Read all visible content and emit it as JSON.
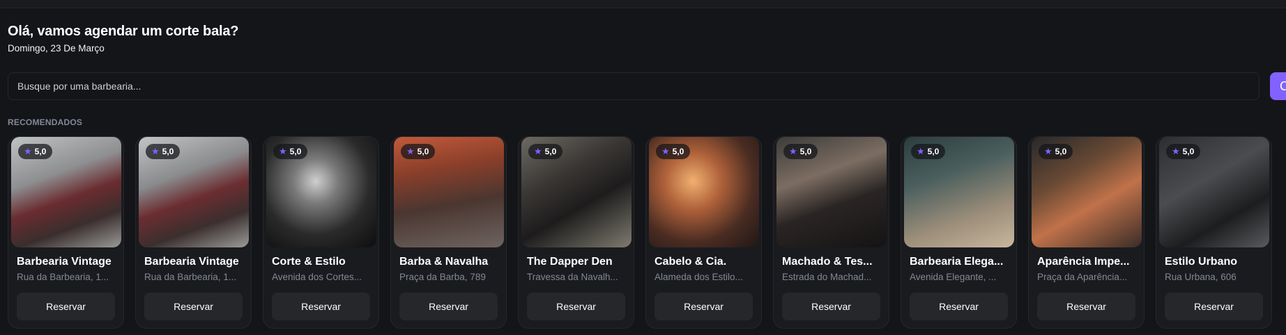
{
  "header": {
    "greeting": "Olá, vamos agendar um corte bala?",
    "date": "Domingo, 23 De Março"
  },
  "search": {
    "placeholder": "Busque por uma barbearia...",
    "button_icon": "search-icon",
    "button_label": "C"
  },
  "section": {
    "title": "RECOMENDADOS"
  },
  "colors": {
    "accent": "#8162ff",
    "background": "#141519",
    "card": "#1a1b1f",
    "muted": "#838896"
  },
  "barbershops": [
    {
      "name": "Barbearia Vintage",
      "address": "Rua da Barbearia, 1...",
      "rating": "5,0",
      "button": "Reservar"
    },
    {
      "name": "Barbearia Vintage",
      "address": "Rua da Barbearia, 1...",
      "rating": "5,0",
      "button": "Reservar"
    },
    {
      "name": "Corte & Estilo",
      "address": "Avenida dos Cortes...",
      "rating": "5,0",
      "button": "Reservar"
    },
    {
      "name": "Barba & Navalha",
      "address": "Praça da Barba, 789",
      "rating": "5,0",
      "button": "Reservar"
    },
    {
      "name": "The Dapper Den",
      "address": "Travessa da Navalh...",
      "rating": "5,0",
      "button": "Reservar"
    },
    {
      "name": "Cabelo & Cia.",
      "address": "Alameda dos Estilo...",
      "rating": "5,0",
      "button": "Reservar"
    },
    {
      "name": "Machado & Tes...",
      "address": "Estrada do Machad...",
      "rating": "5,0",
      "button": "Reservar"
    },
    {
      "name": "Barbearia Elega...",
      "address": "Avenida Elegante, ...",
      "rating": "5,0",
      "button": "Reservar"
    },
    {
      "name": "Aparência Impe...",
      "address": "Praça da Aparência...",
      "rating": "5,0",
      "button": "Reservar"
    },
    {
      "name": "Estilo Urbano",
      "address": "Rua Urbana, 606",
      "rating": "5,0",
      "button": "Reservar"
    }
  ]
}
